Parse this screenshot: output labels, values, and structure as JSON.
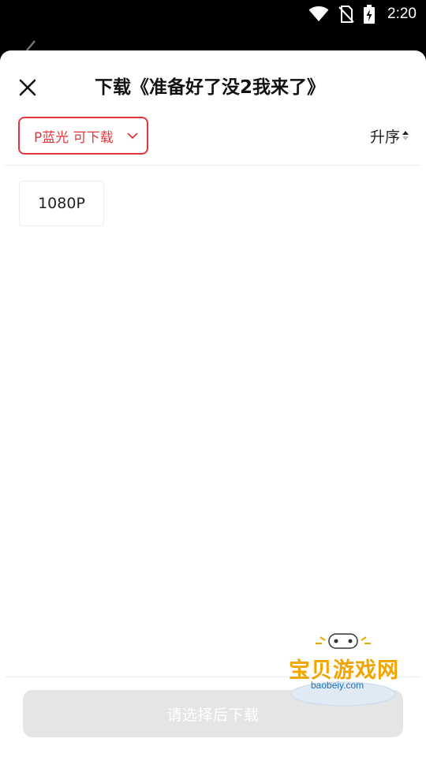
{
  "status_bar": {
    "time": "2:20",
    "icons": [
      "wifi-icon",
      "no-sim-icon",
      "battery-charging-icon"
    ]
  },
  "sheet": {
    "title": "下载《准备好了没2我来了》",
    "close_icon": "close-icon"
  },
  "toolbar": {
    "quality_label": "P蓝光 可下载",
    "sort_label": "升序",
    "accent_color": "#e0383e"
  },
  "options": [
    {
      "label": "1080P"
    }
  ],
  "footer": {
    "download_label": "请选择后下载"
  },
  "watermark": {
    "brand": "宝贝游戏网",
    "domain": "baobeiy.com"
  }
}
